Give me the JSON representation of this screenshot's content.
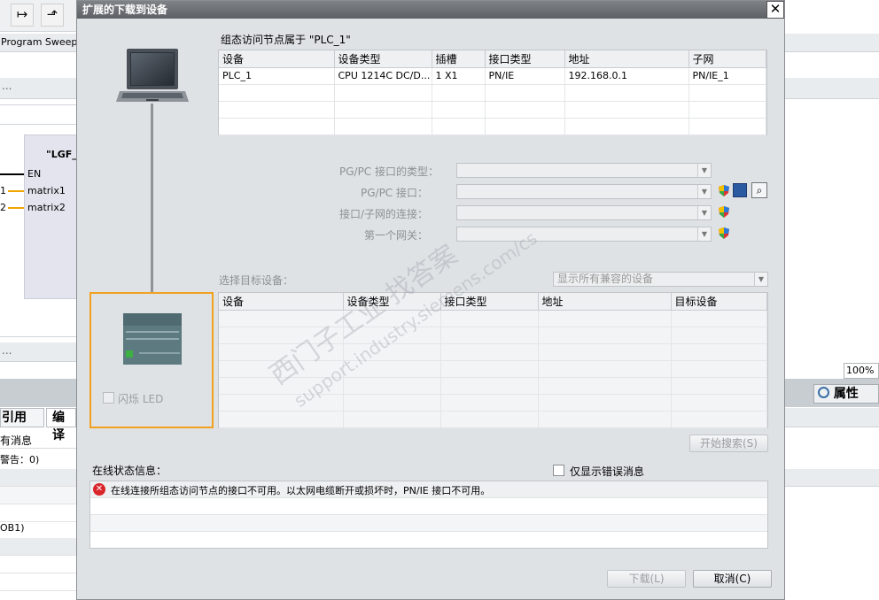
{
  "background": {
    "toolbar_icons": [
      "step-into-icon",
      "step-out-icon"
    ],
    "program_sweep_label": "Program Sweep",
    "ellipsis_1": "...",
    "ellipsis_2": "...",
    "fb_title": "\"LGF_I",
    "en_label": "EN",
    "pin_1_prefix": "1",
    "pin_1_label": "matrix1",
    "pin_2_prefix": "2",
    "pin_2_label": "matrix2",
    "zoom": "100%",
    "tab_references": "引用",
    "tab_compile": "编译",
    "properties_label": "属性",
    "messages_text": "有消息",
    "warnings_text": "警告：0)",
    "ob1_text": "OB1)"
  },
  "dialog": {
    "title": "扩展的下载到设备",
    "close_symbol": "✕",
    "configured_header": "组态访问节点属于 \"PLC_1\"",
    "config_columns": [
      "设备",
      "设备类型",
      "插槽",
      "接口类型",
      "地址",
      "子网"
    ],
    "config_rows": [
      [
        "PLC_1",
        "CPU 1214C DC/D...",
        "1 X1",
        "PN/IE",
        "192.168.0.1",
        "PN/IE_1"
      ]
    ],
    "pgpc_type_label": "PG/PC 接口的类型：",
    "pgpc_interface_label": "PG/PC 接口：",
    "connection_label": "接口/子网的连接：",
    "gateway_label": "第一个网关：",
    "select_target_label": "选择目标设备：",
    "show_compatible_value": "显示所有兼容的设备",
    "target_columns": [
      "设备",
      "设备类型",
      "接口类型",
      "地址",
      "目标设备"
    ],
    "flash_led_label": "闪烁 LED",
    "start_search_label": "开始搜索(S)",
    "online_status_label": "在线状态信息：",
    "only_errors_label": "仅显示错误消息",
    "status_message": "在线连接所组态访问节点的接口不可用。以太网电缆断开或损坏时，PN/IE 接口不可用。",
    "download_label": "下载(L)",
    "cancel_label": "取消(C)",
    "watermark_1": "西门子工业   找答案",
    "watermark_2": "support.industry.siemens.com/cs",
    "colors": {
      "title_bar": "#6b6f74",
      "highlight_border": "#f2a01f",
      "error_red": "#d9262b"
    }
  }
}
